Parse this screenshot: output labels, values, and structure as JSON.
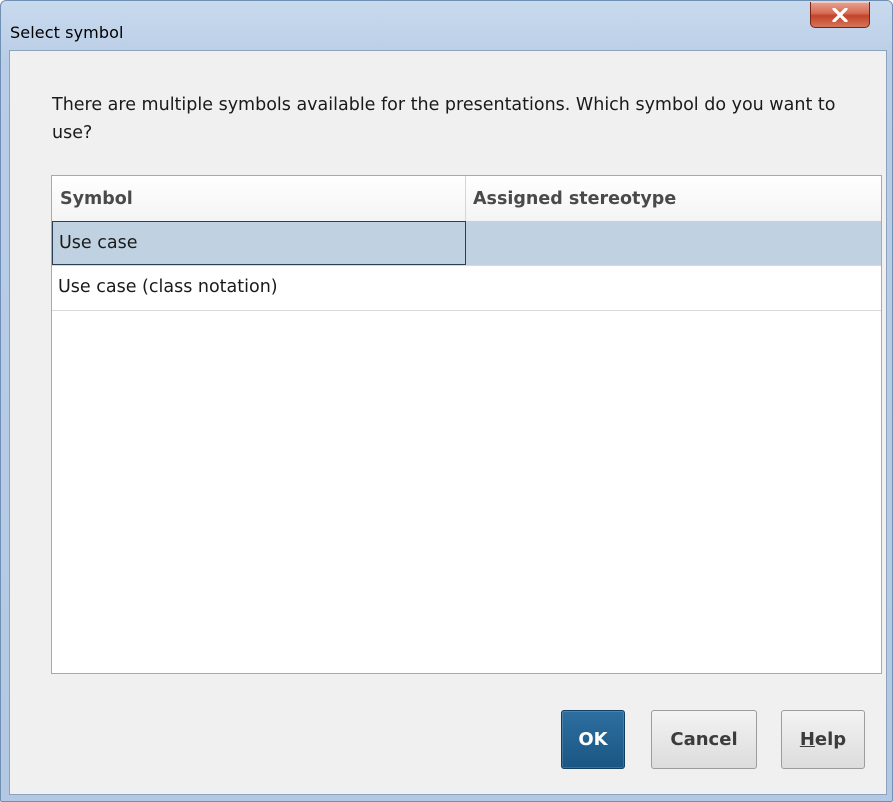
{
  "window": {
    "title": "Select symbol",
    "close_icon": "close-x-icon"
  },
  "dialog": {
    "prompt": "There are multiple symbols available for the presentations. Which symbol do you want to use?"
  },
  "table": {
    "columns": [
      "Symbol",
      "Assigned stereotype"
    ],
    "rows": [
      {
        "symbol": "Use case",
        "stereotype": "",
        "selected": true
      },
      {
        "symbol": "Use case (class notation)",
        "stereotype": "",
        "selected": false
      }
    ]
  },
  "buttons": {
    "ok": "OK",
    "cancel": "Cancel",
    "help_mnemonic": "H",
    "help_rest": "elp"
  },
  "colors": {
    "selection": "#c0d2e2",
    "ok_button": "#1f5f8e",
    "close_button": "#c8452c"
  }
}
